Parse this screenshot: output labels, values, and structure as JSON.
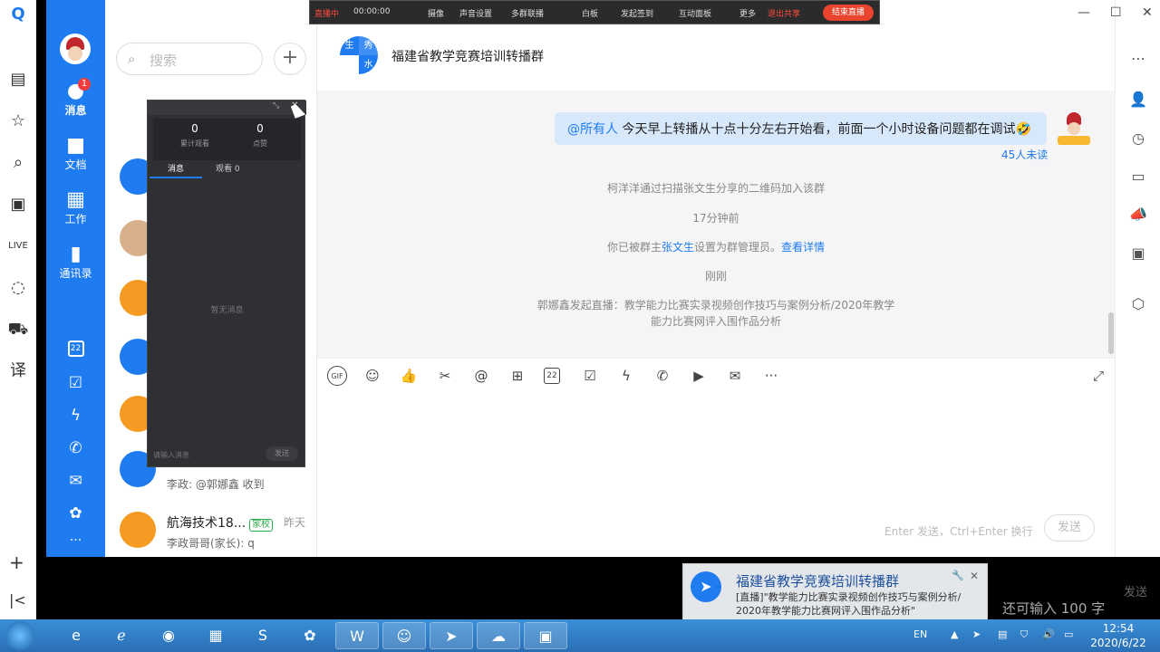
{
  "nav": {
    "items": [
      {
        "label": "消息",
        "icon": "chat-icon",
        "badge": "1"
      },
      {
        "label": "文档",
        "icon": "folder-icon"
      },
      {
        "label": "工作",
        "icon": "grid-icon"
      },
      {
        "label": "通讯录",
        "icon": "contacts-icon"
      }
    ],
    "calendar_day": "22"
  },
  "search": {
    "placeholder": "搜索"
  },
  "conversations": [
    {
      "message": "李政: @郭娜鑫 收到"
    },
    {
      "name": "航海技术18...",
      "tag": "家校",
      "time": "昨天",
      "message": "李政哥哥(家长): q"
    }
  ],
  "chat": {
    "group_title": "福建省教学竞赛培训转播群",
    "group_avatar_chars": [
      "生",
      "秀",
      "",
      "水"
    ],
    "message": {
      "mention": "@所有人",
      "text": " 今天早上转播从十点十分左右开始看，前面一个小时设备问题都在调试🤣"
    },
    "unread": "45人未读",
    "system": [
      "柯洋洋通过扫描张文生分享的二维码加入该群",
      "17分钟前",
      "刚刚",
      "郭娜鑫发起直播：教学能力比赛实录视频创作技巧与案例分析/2020年教学",
      "能力比赛网评入围作品分析"
    ],
    "admin_notice": {
      "pre": "你已被群主",
      "owner": "张文生",
      "mid": "设置为群管理员。",
      "link": "查看详情"
    },
    "input_hint": "Enter 发送，Ctrl+Enter 换行",
    "send": "发送",
    "toolbar_calendar": "22"
  },
  "livebar": {
    "status": "直播中",
    "timer": "00:00:00",
    "items": [
      "摄像",
      "声音设置",
      "多群联播",
      "白板",
      "发起签到",
      "互动面板",
      "更多",
      "退出共享"
    ],
    "end_button": "结束直播"
  },
  "livepanel": {
    "stats": [
      {
        "value": "0",
        "label": "累计观看"
      },
      {
        "value": "0",
        "label": "点赞"
      }
    ],
    "tabs": [
      "消息",
      "观看 0"
    ],
    "empty": "暂无消息",
    "input_placeholder": "请输入消息",
    "send": "发送"
  },
  "notification": {
    "title": "福建省教学竞赛培训转播群",
    "body_line1": "[直播]\"教学能力比赛实录视频创作技巧与案例分析/",
    "body_line2": "2020年教学能力比赛网评入围作品分析\""
  },
  "background": {
    "send": "发送",
    "remaining": "还可输入 100 字"
  },
  "taskbar": {
    "lang": "EN",
    "time": "12:54",
    "date": "2020/6/22"
  },
  "colors": {
    "brand": "#1e7bf0",
    "live_red": "#e8442e",
    "bubble": "#d7e8fb"
  }
}
